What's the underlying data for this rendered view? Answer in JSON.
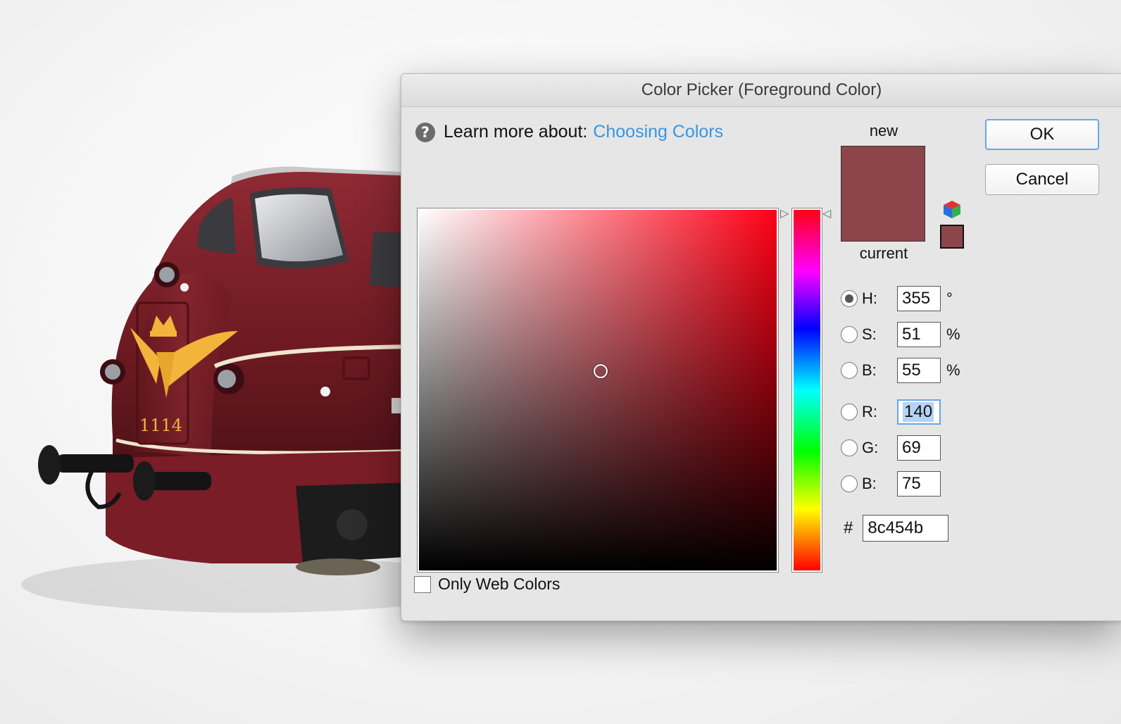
{
  "dialog": {
    "title": "Color Picker (Foreground Color)",
    "help_prefix": "Learn more about:",
    "help_link": "Choosing Colors"
  },
  "swatches": {
    "new_label": "new",
    "current_label": "current",
    "new_color": "#8c454b",
    "current_color": "#8c454b"
  },
  "buttons": {
    "ok": "OK",
    "cancel": "Cancel"
  },
  "fields": {
    "h": {
      "label": "H:",
      "value": "355",
      "unit": "°",
      "selected": true
    },
    "s": {
      "label": "S:",
      "value": "51",
      "unit": "%"
    },
    "b": {
      "label": "B:",
      "value": "55",
      "unit": "%"
    },
    "r": {
      "label": "R:",
      "value": "140"
    },
    "g": {
      "label": "G:",
      "value": "69"
    },
    "b2": {
      "label": "B:",
      "value": "75"
    }
  },
  "hex": {
    "label": "#",
    "value": "8c454b"
  },
  "web_colors_label": "Only Web Colors",
  "colors": {
    "accent": "#3a95e0",
    "focus": "#6aa6e6",
    "pure_hue": "#ff0015",
    "locomotive": "#7b1c26",
    "emblem": "#f2b43a"
  },
  "photo": {
    "locomotive_number": "1114"
  }
}
